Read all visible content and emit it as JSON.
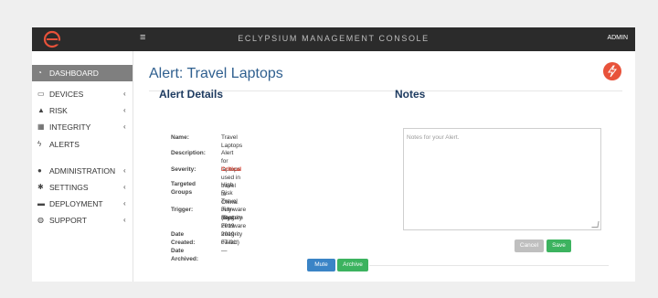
{
  "app": {
    "console_title": "ECLYPSIUM MANAGEMENT CONSOLE",
    "user": "ADMIN",
    "menu_icon": "≡",
    "accent": "#e8523a"
  },
  "sidebar": {
    "items": [
      {
        "icon": "tachometer-icon",
        "glyph": "◔",
        "label": "DASHBOARD"
      },
      {
        "icon": "monitor-icon",
        "glyph": "▭",
        "label": "DEVICES",
        "chevron": "‹"
      },
      {
        "icon": "warning-icon",
        "glyph": "▲",
        "label": "RISK",
        "chevron": "‹"
      },
      {
        "icon": "grid-icon",
        "glyph": "▦",
        "label": "INTEGRITY",
        "chevron": "‹"
      },
      {
        "icon": "bolt-icon",
        "glyph": "ϟ",
        "label": "ALERTS"
      },
      {
        "icon": "user-icon",
        "glyph": "●",
        "label": "ADMINISTRATION",
        "chevron": "‹"
      },
      {
        "icon": "gear-icon",
        "glyph": "✱",
        "label": "SETTINGS",
        "chevron": "‹"
      },
      {
        "icon": "briefcase-icon",
        "glyph": "▬",
        "label": "DEPLOYMENT",
        "chevron": "‹"
      },
      {
        "icon": "lifebuoy-icon",
        "glyph": "◍",
        "label": "SUPPORT",
        "chevron": "‹"
      }
    ]
  },
  "page": {
    "title": "Alert: Travel Laptops"
  },
  "details": {
    "title": "Alert Details",
    "name_label": "Name:",
    "name_value": "Travel Laptops",
    "description_label": "Description:",
    "description_value": "Alert for laptops used in travel to China.",
    "severity_label": "Severity:",
    "severity_value": "Critical",
    "groups_label_1": "Targeted",
    "groups_label_2": "Groups",
    "groups_value": "High Risk Travel July-Sept 2019",
    "trigger_label": "Trigger:",
    "trigger_value_1": "Firmware Integrity",
    "trigger_value_2": "(System Firmware Integrity Failed)",
    "created_label": "Date Created:",
    "created_value": "2019-07-01",
    "archived_label": "Date Archived:",
    "archived_value": "—",
    "mute_label": "Mute",
    "archive_label": "Archive"
  },
  "notes": {
    "title": "Notes",
    "placeholder": "Notes for your Alert.",
    "cancel_label": "Cancel",
    "save_label": "Save"
  }
}
